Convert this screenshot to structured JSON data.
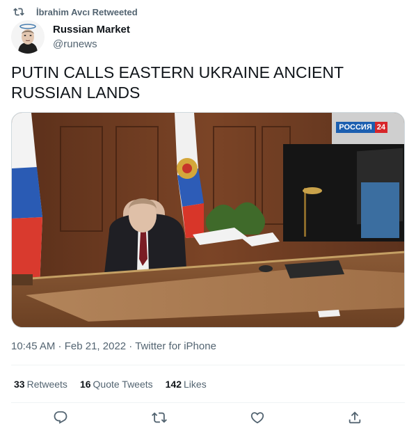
{
  "retweet": {
    "text": "İbrahim Avcı Retweeted"
  },
  "author": {
    "name": "Russian Market",
    "handle": "@runews"
  },
  "tweet": {
    "text": "PUTIN CALLS EASTERN UKRAINE ANCIENT RUSSIAN LANDS"
  },
  "media": {
    "channel_name": "РОССИЯ",
    "channel_number": "24"
  },
  "meta": {
    "time": "10:45 AM",
    "date": "Feb 21, 2022",
    "source": "Twitter for iPhone",
    "separator": " · "
  },
  "stats": [
    {
      "count": "33",
      "label": "Retweets"
    },
    {
      "count": "16",
      "label": "Quote Tweets"
    },
    {
      "count": "142",
      "label": "Likes"
    }
  ],
  "actions": [
    {
      "icon": "reply-icon"
    },
    {
      "icon": "retweet-icon"
    },
    {
      "icon": "like-icon"
    },
    {
      "icon": "share-icon"
    }
  ],
  "colors": {
    "text": "#0f1419",
    "secondary": "#536471",
    "divider": "#eff3f4"
  }
}
